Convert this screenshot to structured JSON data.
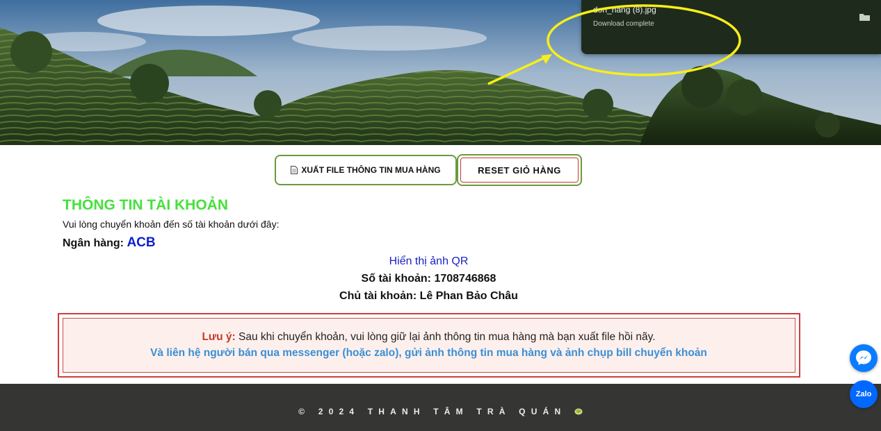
{
  "download": {
    "filename": "don_hang (8).jpg",
    "status": "Download complete"
  },
  "buttons": {
    "export_label": "XUẤT FILE THÔNG TIN MUA HÀNG",
    "reset_label": "RESET GIỎ HÀNG"
  },
  "account": {
    "title": "THÔNG TIN TÀI KHOẢN",
    "instruction": "Vui lòng chuyển khoản đến số tài khoản dưới đây:",
    "bank_label": "Ngân hàng:",
    "bank_name": "ACB",
    "qr_link": "Hiển thị ảnh QR",
    "number_line": "Số tài khoản: 1708746868",
    "owner_line": "Chủ tài khoản: Lê Phan Bảo Châu"
  },
  "note": {
    "label": "Lưu ý:",
    "text": " Sau khi chuyển khoản, vui lòng giữ lại ảnh thông tin mua hàng mà bạn xuất file hồi nãy.",
    "contact": "Và liên hệ người bán qua messenger (hoặc zalo), gửi ảnh thông tin mua hàng và ảnh chụp bill chuyển khoản"
  },
  "footer": {
    "copyright": "© 2024 THANH TÂM TRÀ QUÁN"
  },
  "chat": {
    "messenger_icon": "messenger-icon",
    "zalo_label": "Zalo"
  },
  "colors": {
    "title_green": "#46e03c",
    "bank_blue": "#0d1fcf",
    "note_red": "#c0392b",
    "contact_blue": "#3a8fd6",
    "footer_bg": "#353534",
    "button_border": "#6a9a3c"
  }
}
